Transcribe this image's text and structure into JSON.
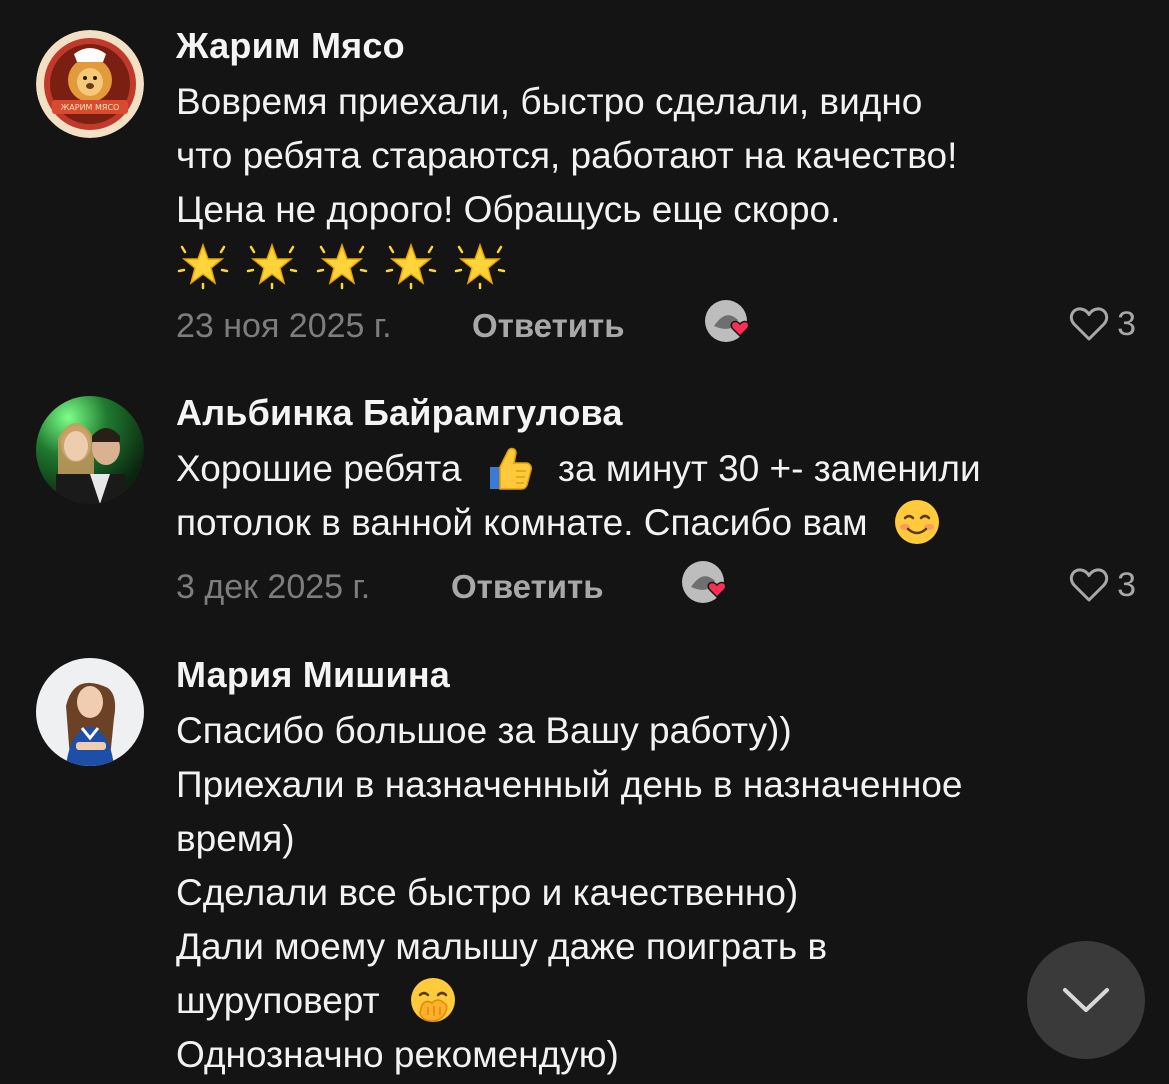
{
  "comments": [
    {
      "author": "Жарим Мясо",
      "lines": [
        "Вовремя приехали, быстро сделали, видно",
        "что ребята стараются, работают на качество!",
        "Цена не дорого! Обращусь еще скоро."
      ],
      "stars_count": 5,
      "date": "23 ноя 2025 г.",
      "reply_label": "Ответить",
      "likes": "3",
      "avatar_logo_text": "ЖАРИМ МЯСО"
    },
    {
      "author": "Альбинка Байрамгулова",
      "line1_before": "Хорошие ребята",
      "line1_after": "за минут 30 +- заменили",
      "line2": "потолок в ванной комнате. Спасибо вам",
      "date": "3 дек 2025 г.",
      "reply_label": "Ответить",
      "likes": "3"
    },
    {
      "author": "Мария Мишина",
      "lines": [
        "Спасибо большое за Вашу работу))",
        "Приехали в назначенный день в назначенное",
        "время)",
        "Сделали все быстро и качественно)",
        "Дали моему малышу даже поиграть в"
      ],
      "line6": "шуруповерт",
      "line7": "Однозначно рекомендую)"
    }
  ],
  "icons": {
    "heart": "heart-outline-icon",
    "scroll_down": "chevron-down-icon",
    "star": "star-sparkle-emoji",
    "thumbs_up": "thumbs-up-emoji",
    "smile": "smiling-blush-emoji",
    "hand_over_mouth": "hand-over-mouth-emoji",
    "liked_by_author": "author-heart-badge-icon"
  },
  "colors": {
    "background": "#141414",
    "text": "#f2f2f2",
    "secondary": "#7d7d7d",
    "accent_heart": "#ff2d55"
  }
}
